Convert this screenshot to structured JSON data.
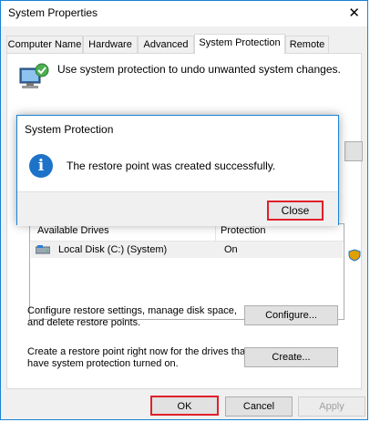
{
  "window": {
    "title": "System Properties",
    "close_glyph": "✕"
  },
  "tabs": [
    {
      "label": "Computer Name"
    },
    {
      "label": "Hardware"
    },
    {
      "label": "Advanced"
    },
    {
      "label": "System Protection",
      "active": true
    },
    {
      "label": "Remote"
    }
  ],
  "header": {
    "text": "Use system protection to undo unwanted system changes.",
    "icon": "computer-shield-icon"
  },
  "drives": {
    "columns": [
      "Available Drives",
      "Protection"
    ],
    "rows": [
      {
        "name": "Local Disk (C:) (System)",
        "protection": "On"
      }
    ]
  },
  "configure": {
    "description": "Configure restore settings, manage disk space,\nand delete restore points.",
    "button": "Configure..."
  },
  "create": {
    "description": "Create a restore point right now for the drives that\nhave system protection turned on.",
    "button": "Create..."
  },
  "footer": {
    "ok": "OK",
    "cancel": "Cancel",
    "apply": "Apply"
  },
  "dialog": {
    "title": "System Protection",
    "message": "The restore point was created successfully.",
    "close_button": "Close",
    "icon": "info-icon"
  },
  "colors": {
    "accent": "#1883d7",
    "highlight": "#e0202a",
    "info": "#1d73c8"
  }
}
